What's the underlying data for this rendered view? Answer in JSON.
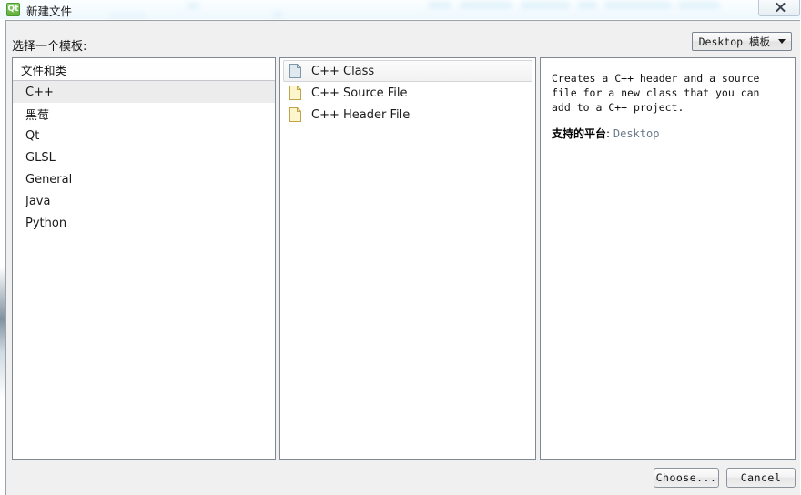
{
  "window": {
    "title": "新建文件",
    "app_icon": "qt-logo-icon",
    "close_label": "close-icon"
  },
  "toolbar": {
    "prompt": "选择一个模板:",
    "template_combo": {
      "value": "Desktop 模板",
      "arrow": "chevron-down-icon"
    }
  },
  "categories": {
    "header": "文件和类",
    "items": [
      {
        "label": "C++",
        "selected": true
      },
      {
        "label": "黑莓",
        "selected": false
      },
      {
        "label": "Qt",
        "selected": false
      },
      {
        "label": "GLSL",
        "selected": false
      },
      {
        "label": "General",
        "selected": false
      },
      {
        "label": "Java",
        "selected": false
      },
      {
        "label": "Python",
        "selected": false
      }
    ]
  },
  "templates": {
    "items": [
      {
        "label": "C++ Class",
        "icon": "file-icon-blue",
        "selected": true
      },
      {
        "label": "C++ Source File",
        "icon": "file-icon-yellow",
        "selected": false
      },
      {
        "label": "C++ Header File",
        "icon": "file-icon-yellow",
        "selected": false
      }
    ]
  },
  "details": {
    "description": "Creates a C++ header and a source file for a new class that you can add to a C++ project.",
    "platform_label": "支持的平台",
    "platform_separator": ": ",
    "platform_value": "Desktop"
  },
  "footer": {
    "choose_label": "Choose...",
    "cancel_label": "Cancel"
  },
  "colors": {
    "dialog_bg": "#f0f0f0",
    "panel_bg": "#ffffff",
    "panel_border": "#7f8893",
    "selection_bg": "#ececec",
    "platform_value": "#6b7b8c",
    "titlebar_glass": "#f4fbff",
    "qt_green": "#5fae3d"
  }
}
